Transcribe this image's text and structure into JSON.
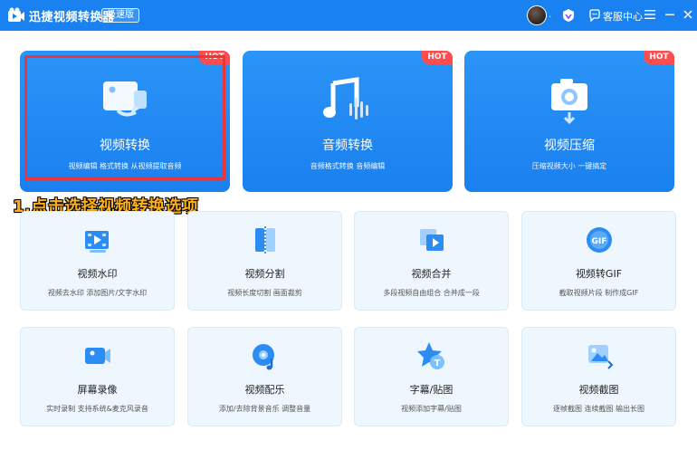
{
  "app": {
    "title": "迅捷视频转换器",
    "edition": "极速版",
    "avatar_suffix": ".",
    "service_label": "客服中心"
  },
  "big_cards": [
    {
      "title": "视频转换",
      "desc": "视频编辑 格式转换 从视频提取音频",
      "hot": "HOT",
      "icon": "video-convert-icon"
    },
    {
      "title": "音频转换",
      "desc": "音频格式转换 音频编辑",
      "hot": "HOT",
      "icon": "audio-convert-icon"
    },
    {
      "title": "视频压缩",
      "desc": "压缩视频大小 一键搞定",
      "hot": "HOT",
      "icon": "video-compress-icon"
    }
  ],
  "annotation": "1.点击选择视频转换选项",
  "small_cards": [
    {
      "title": "视频水印",
      "desc": "视频去水印 添加图片/文字水印",
      "icon": "watermark-icon"
    },
    {
      "title": "视频分割",
      "desc": "视频长度切割 画面裁剪",
      "icon": "split-icon"
    },
    {
      "title": "视频合并",
      "desc": "多段视频自由组合 合并成一段",
      "icon": "merge-icon"
    },
    {
      "title": "视频转GIF",
      "desc": "截取视频片段 制作成GIF",
      "icon": "gif-icon"
    },
    {
      "title": "屏幕录像",
      "desc": "实时录制 支持系统&麦克风录音",
      "icon": "screen-record-icon"
    },
    {
      "title": "视频配乐",
      "desc": "添加/去除背景音乐 调整音量",
      "icon": "music-icon"
    },
    {
      "title": "字幕/贴图",
      "desc": "视频添加字幕/贴图",
      "icon": "subtitle-icon"
    },
    {
      "title": "视频截图",
      "desc": "逐帧截图 连续截图 输出长图",
      "icon": "screenshot-icon"
    }
  ],
  "colors": {
    "titlebar": "#1a82f0",
    "card_blue": "#1a80ef",
    "hot": "#ff4d4f",
    "highlight": "#e8363c",
    "annotation": "#ffb018"
  }
}
